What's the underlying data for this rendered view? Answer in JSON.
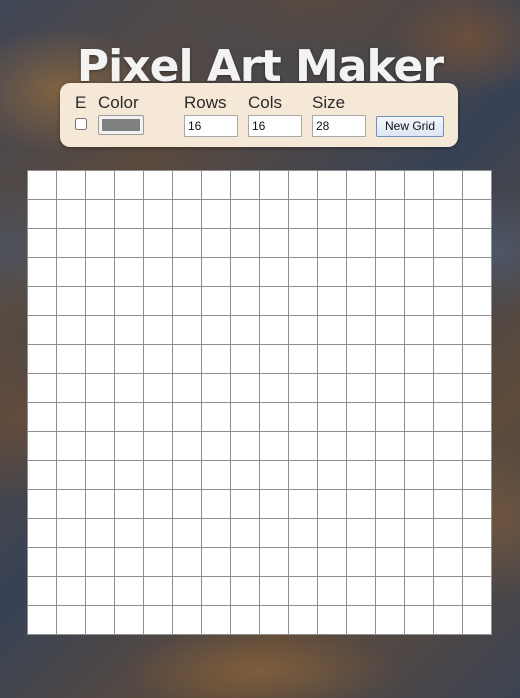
{
  "page": {
    "title": "Pixel Art Maker"
  },
  "controls": {
    "erase_label": "E",
    "erase_checked": false,
    "color_label": "Color",
    "color_value": "#808080",
    "rows_label": "Rows",
    "rows_value": "16",
    "cols_label": "Cols",
    "cols_value": "16",
    "size_label": "Size",
    "size_value": "28",
    "new_grid_label": "New Grid"
  },
  "grid": {
    "rows": 16,
    "cols": 16,
    "cell_color": "#ffffff",
    "line_color": "#8f8f8f"
  }
}
